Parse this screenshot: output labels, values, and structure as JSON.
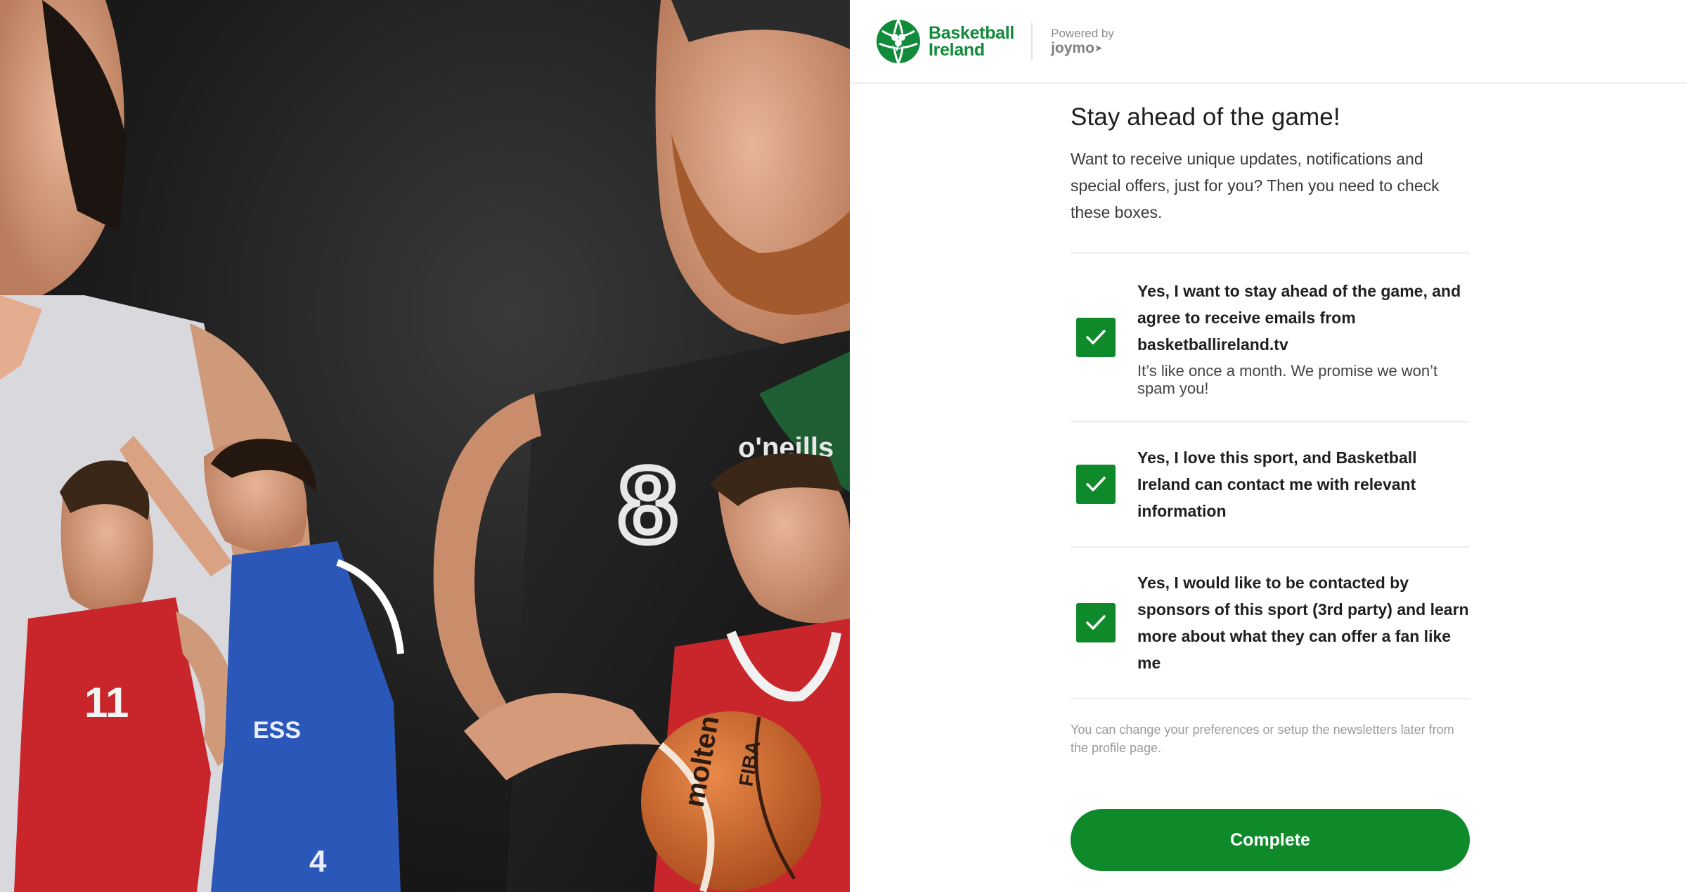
{
  "header": {
    "brand": {
      "line1": "Basketball",
      "line2": "Ireland"
    },
    "powered_by": "Powered by",
    "powered_name": "joymo"
  },
  "main": {
    "title": "Stay ahead of the game!",
    "intro": "Want to receive unique updates, notifications and special offers, just for you? Then you need to check these boxes.",
    "options": [
      {
        "checked": true,
        "label": "Yes, I want to stay ahead of the game, and agree to receive emails from basketballireland.tv",
        "note": "It’s like once a month. We promise we won’t spam you!"
      },
      {
        "checked": true,
        "label": "Yes, I love this sport, and Basketball Ireland can contact me with relevant information"
      },
      {
        "checked": true,
        "label": "Yes, I would like to be contacted by sponsors of this sport (3rd party) and learn more about what they can offer a fan like me"
      }
    ],
    "footnote": "You can change your preferences or setup the newsletters later from the profile page.",
    "complete_label": "Complete"
  },
  "hero_image": {
    "jersey_numbers": [
      "11",
      "8",
      "4"
    ],
    "ball_text": [
      "molten",
      "FIBA"
    ],
    "jersey_text": [
      "o'neills",
      "ESS"
    ]
  },
  "colors": {
    "brand_green": "#118a3a",
    "checkbox_green": "#0f8a2b",
    "button_green": "#0f8a2b"
  }
}
